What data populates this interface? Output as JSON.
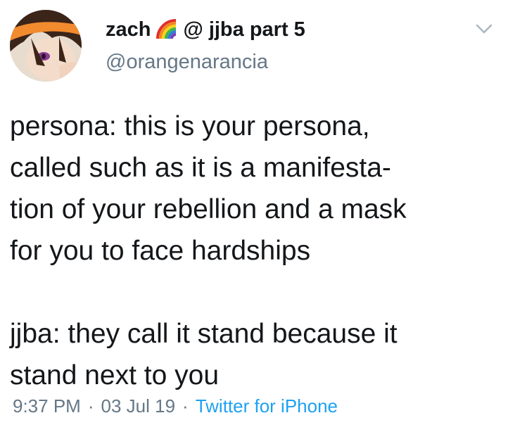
{
  "tweet": {
    "display_name": "zach",
    "name_emoji": "rainbow-emoji",
    "name_suffix": "@ jjba part 5",
    "handle": "@orangenarancia",
    "paragraph_1": "persona: this is your persona,\ncalled such as it is a manifesta-\ntion of your rebellion and a mask\nfor you to face hardships",
    "paragraph_2": "jjba: they call it stand because it\nstand next to you",
    "time": "9:37 PM",
    "date": "03 Jul 19",
    "source": "Twitter for iPhone",
    "separator": "·"
  },
  "icons": {
    "avatar": "anime-avatar",
    "menu": "chevron-down-icon"
  },
  "colors": {
    "text": "#14171a",
    "muted": "#657786",
    "link": "#1da1f2",
    "avatar_accent": "#f28a2e"
  }
}
